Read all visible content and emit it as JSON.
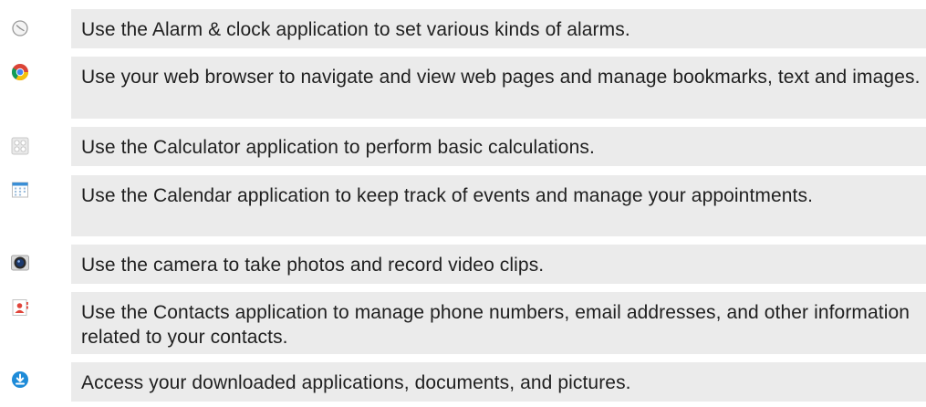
{
  "apps": [
    {
      "icon": "alarm-clock-icon",
      "description": "Use the Alarm & clock application to set various kinds of alarms."
    },
    {
      "icon": "web-browser-icon",
      "description": "Use your web browser to navigate and view web pages and manage bookmarks, text and images."
    },
    {
      "icon": "calculator-icon",
      "description": "Use the Calculator application to perform basic calculations."
    },
    {
      "icon": "calendar-icon",
      "description": "Use the Calendar application to keep track of events and manage your appointments."
    },
    {
      "icon": "camera-icon",
      "description": "Use the camera to take photos and record video clips."
    },
    {
      "icon": "contacts-icon",
      "description": "Use the Contacts application to manage phone numbers, email addresses, and other information related to your contacts."
    },
    {
      "icon": "downloads-icon",
      "description": "Access your downloaded applications, documents, and pictures."
    }
  ],
  "colors": {
    "row_background": "#ebebeb",
    "text": "#1f1f1f",
    "browser_red": "#db4437",
    "browser_yellow": "#f4c20d",
    "browser_green": "#0f9d58",
    "browser_blue": "#4285f4",
    "contacts_red": "#e0443a",
    "downloads_blue": "#1e8bd8"
  }
}
